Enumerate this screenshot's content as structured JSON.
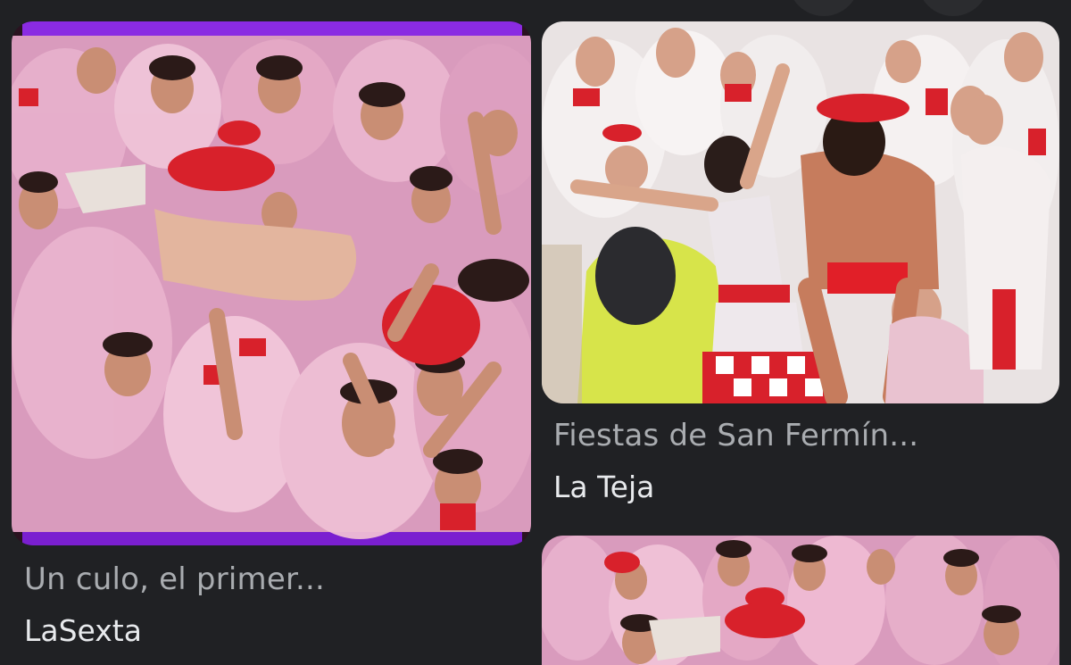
{
  "results": [
    {
      "title": "Un culo, el primer...",
      "source": "LaSexta",
      "image_alt": "Crowd in pink-stained white shirts celebrating San Fermín with a man crowd-surfing"
    },
    {
      "title": "Fiestas de San Fermín...",
      "source": "La Teja",
      "image_alt": "Woman and shirtless man with red hat carried on shoulders in San Fermín crowd"
    },
    {
      "title": "",
      "source": "",
      "image_alt": "Crowd in pink-stained white shirts celebrating San Fermín"
    }
  ],
  "colors": {
    "background": "#202124",
    "title_text": "#a9acb0",
    "source_text": "#e8eaed",
    "frame_purple": "#8a2be2",
    "wine_pink": "#e7a9c8",
    "festival_red": "#d8212b"
  }
}
